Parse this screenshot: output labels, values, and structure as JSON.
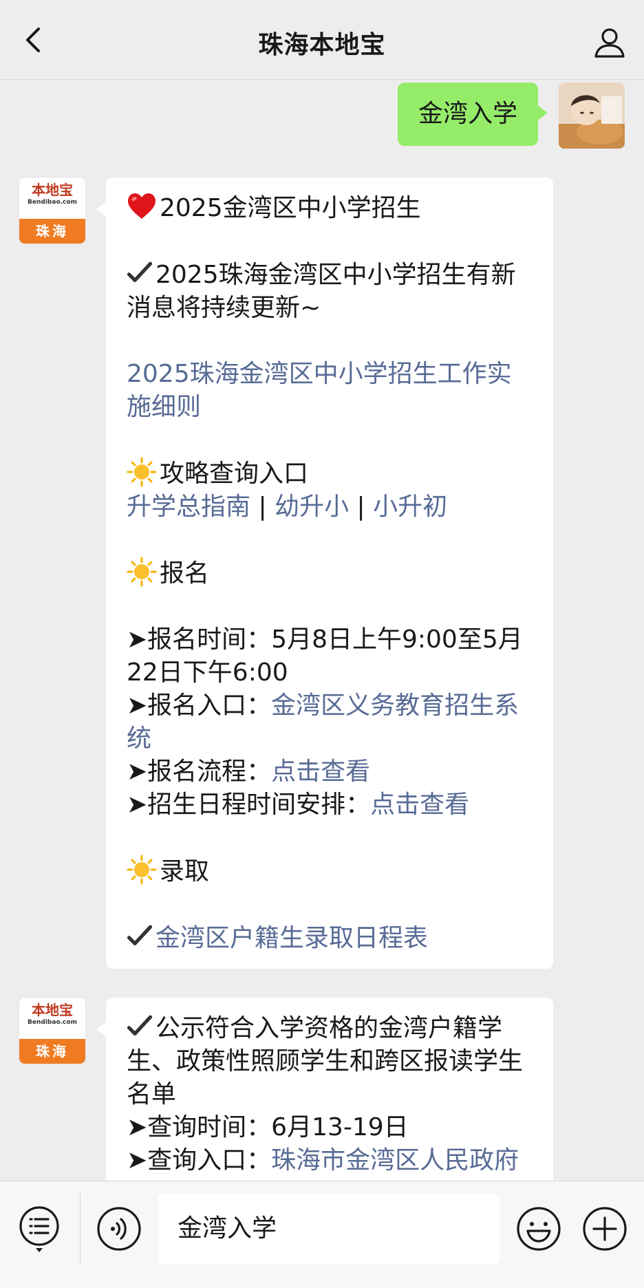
{
  "header": {
    "title": "珠海本地宝",
    "back_icon": "chevron-left-icon",
    "profile_icon": "person-icon"
  },
  "sent": {
    "text": "金湾入学"
  },
  "bot": {
    "logo_cn": "本地宝",
    "logo_en": "Bendibao.com",
    "logo_city": "珠海",
    "brand_color": "#f07b22"
  },
  "msg1": {
    "title": "2025金湾区中小学招生",
    "update_note": "2025珠海金湾区中小学招生有新消息将持续更新~",
    "rules_link": "2025珠海金湾区中小学招生工作实施细则",
    "guide_heading": "攻略查询入口",
    "guide_link_1": "升学总指南",
    "sep": "|",
    "guide_link_2": "幼升小",
    "guide_link_3": "小升初",
    "signup_heading": "报名",
    "time_label": "➤报名时间：",
    "time_value": "5月8日上午9:00至5月22日下午6:00",
    "entry_label": "➤报名入口：",
    "entry_link": "金湾区义务教育招生系统",
    "process_label": "➤报名流程：",
    "process_link": "点击查看",
    "schedule_label": "➤招生日程时间安排：",
    "schedule_link": "点击查看",
    "admit_heading": "录取",
    "admit_link": "金湾区户籍生录取日程表"
  },
  "msg2": {
    "notice": "公示符合入学资格的金湾户籍学生、政策性照顾学生和跨区报读学生名单",
    "query_time_label": "➤查询时间：",
    "query_time_value": "6月13-19日",
    "query_entry_label": "➤查询入口：",
    "query_entry_link": "珠海市金湾区人民政府"
  },
  "toolbar": {
    "input_value": "金湾入学"
  },
  "colors": {
    "sent_bubble": "#95ec69",
    "link": "#576b95",
    "background": "#ededed"
  }
}
